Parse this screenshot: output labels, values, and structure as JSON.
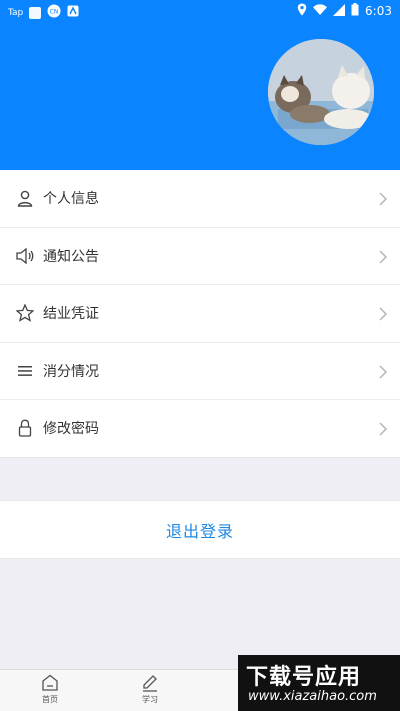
{
  "status_bar": {
    "left_text": "Tap",
    "time": "6:03",
    "icons": [
      "app-square-icon",
      "cn-icon",
      "a-square-icon",
      "location-icon",
      "wifi-icon",
      "signal-icon",
      "battery-icon"
    ]
  },
  "header": {
    "background": "#0a84ff",
    "avatar": "cat-photo"
  },
  "menu": {
    "items": [
      {
        "label": "个人信息",
        "icon": "person-icon"
      },
      {
        "label": "通知公告",
        "icon": "speaker-icon"
      },
      {
        "label": "结业凭证",
        "icon": "star-icon"
      },
      {
        "label": "消分情况",
        "icon": "list-icon"
      },
      {
        "label": "修改密码",
        "icon": "lock-icon"
      }
    ]
  },
  "logout": {
    "label": "退出登录",
    "color": "#1e88e5"
  },
  "tabbar": {
    "tabs": [
      {
        "label": "首页",
        "icon": "home-icon"
      },
      {
        "label": "学习",
        "icon": "pencil-icon"
      }
    ]
  },
  "watermark": {
    "title": "下载号应用",
    "url": "www.xiazaihao.com"
  }
}
